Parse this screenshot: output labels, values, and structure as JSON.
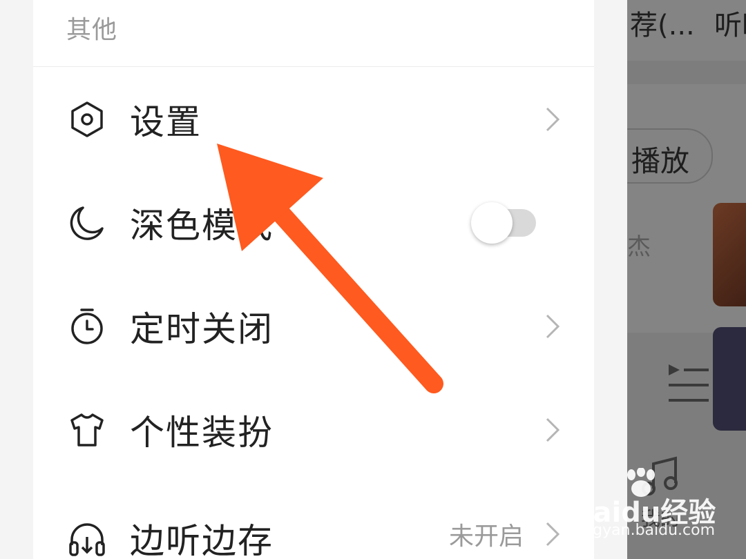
{
  "drawer": {
    "section_title": "其他",
    "items": [
      {
        "label": "设置",
        "icon": "hexagon-settings-icon",
        "control": "chevron"
      },
      {
        "label": "深色模式",
        "icon": "moon-icon",
        "control": "toggle",
        "toggle_on": false
      },
      {
        "label": "定时关闭",
        "icon": "timer-icon",
        "control": "chevron"
      },
      {
        "label": "个性装扮",
        "icon": "tshirt-icon",
        "control": "chevron"
      },
      {
        "label": "边听边存",
        "icon": "headphones-download-icon",
        "control": "chevron",
        "value": "未开启"
      }
    ]
  },
  "background_app": {
    "tab_1": "荐(...",
    "tab_2": "听时",
    "play_chip": "播放",
    "artist_fragment": "杰",
    "nav_label_fragment": "我的"
  },
  "annotation": {
    "color": "#ff5a1f"
  },
  "watermark": {
    "brand": "Baidu经验",
    "url": "jingyan.baidu.com"
  }
}
